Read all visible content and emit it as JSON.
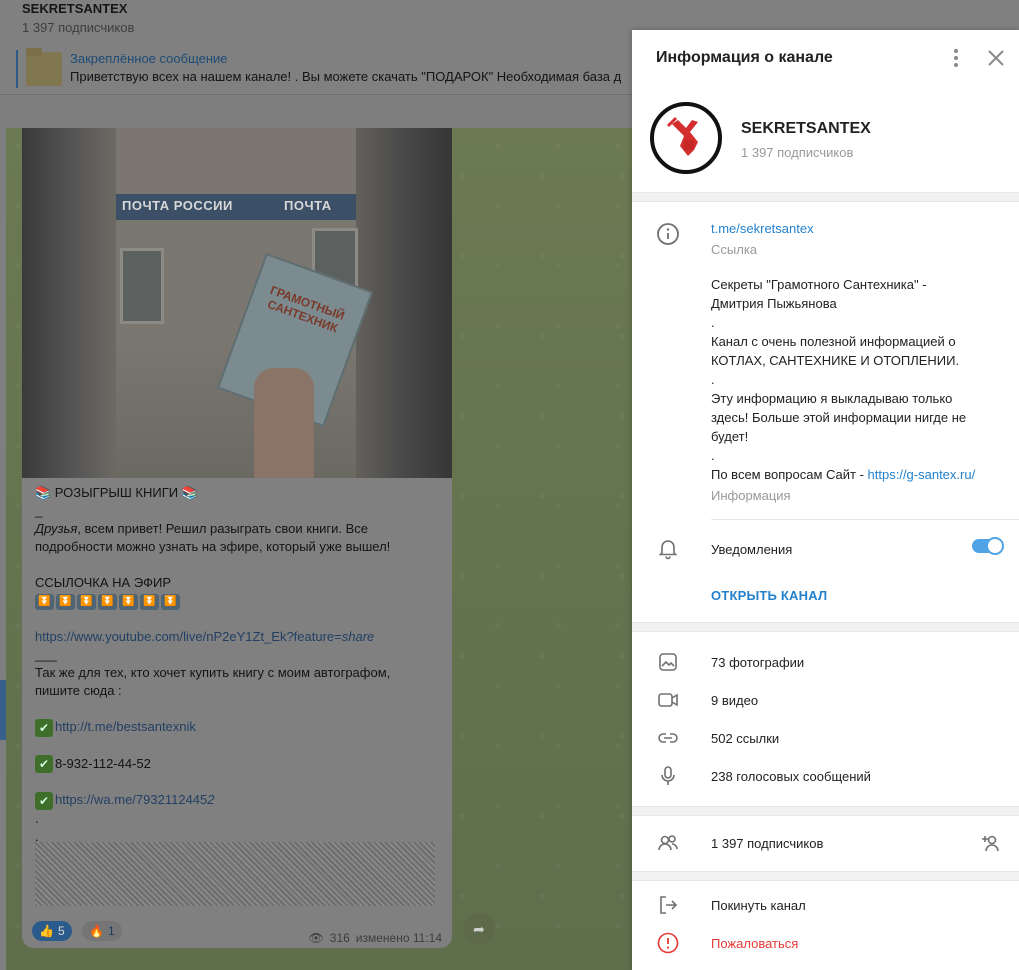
{
  "chat": {
    "title": "SEKRETSANTEX",
    "subscribers": "1 397 подписчиков",
    "pinned_title": "Закреплённое сообщение",
    "pinned_text": "Приветствую всех на нашем канале!  .  Вы можете скачать \"ПОДАРОК\" Необходимая база д"
  },
  "photo": {
    "sign_left": "ПОЧТА РОССИИ",
    "sign_right": "ПОЧТА",
    "book_title": "ГРАМОТНЫЙ САНТЕХНИК"
  },
  "message": {
    "l1": "📚 РОЗЫГРЫШ КНИГИ 📚",
    "l2": "_",
    "l3a": "Друзья",
    "l3b": ", всем привет! Решил разыграть свои книги. Все",
    "l4": "подробности можно узнать на эфире, который уже вышел!",
    "l5": "ССЫЛОЧКА НА ЭФИР",
    "l6_link": "https://www.youtube.com/live/nP2eY1Zt_Ek?feature=",
    "l6_end": "share",
    "l7": "___",
    "l8": "Так же для тех, кто хочет купить книгу с моим автографом,",
    "l9": "пишите сюда :",
    "link1": "http://t.me/bestsantexnik",
    "phone": "8-932-112-44-52",
    "link2a": "https://wa.me/7932112445",
    "link2b": "2",
    "dot": ".",
    "react1_count": "5",
    "react2_count": "1",
    "views": "316",
    "edited": "изменено 11:14"
  },
  "panel": {
    "title": "Информация о канале",
    "name": "SEKRETSANTEX",
    "subscribers": "1 397 подписчиков",
    "link": "t.me/sekretsantex",
    "link_caption": "Ссылка",
    "description": [
      "Секреты \"Грамотного Сантехника\" -",
      "Дмитрия Пыжьянова",
      ".",
      "Канал с очень полезной информацией о",
      "КОТЛАХ, САНТЕХНИКЕ И ОТОПЛЕНИИ.",
      ".",
      "Эту информацию я выкладываю только",
      "здесь! Больше этой информации нигде не",
      "будет!",
      "."
    ],
    "site_prefix": "По всем вопросам Сайт - ",
    "site_link": "https://g-santex.ru/",
    "info_caption": "Информация",
    "notifications": "Уведомления",
    "notifications_on": true,
    "open_channel": "ОТКРЫТЬ КАНАЛ",
    "media": {
      "photos": "73 фотографии",
      "videos": "9 видео",
      "links": "502 ссылки",
      "voice": "238 голосовых сообщений"
    },
    "members": "1 397 подписчиков",
    "leave": "Покинуть канал",
    "report": "Пожаловаться"
  },
  "colors": {
    "accent": "#2481cc",
    "danger": "#e53935",
    "toggle": "#4ea4e6"
  }
}
